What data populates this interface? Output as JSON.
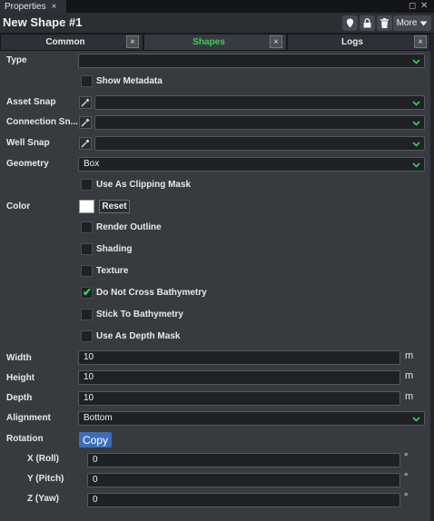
{
  "window": {
    "tab_title": "Properties",
    "tab_close": "×",
    "restore_glyph": "◻",
    "close_glyph": "✕"
  },
  "header": {
    "title": "New Shape #1",
    "icons": [
      "location-pin-icon",
      "lock-icon",
      "trash-icon"
    ],
    "more_label": "More",
    "more_icon": "caret-down-icon"
  },
  "tabs": [
    {
      "label": "Common",
      "active": false,
      "close": "×"
    },
    {
      "label": "Shapes",
      "active": true,
      "close": "×"
    },
    {
      "label": "Logs",
      "active": false,
      "close": "×"
    }
  ],
  "accent_color": "#3ccf55",
  "button_color": "#3b6eb8",
  "form": {
    "type": {
      "label": "Type",
      "value": ""
    },
    "show_metadata": {
      "label": "Show Metadata",
      "checked": false
    },
    "asset_snap": {
      "label": "Asset Snap",
      "value": "",
      "icon": "eyedropper-icon"
    },
    "connection_snap": {
      "label": "Connection Sn...",
      "value": "",
      "icon": "eyedropper-icon"
    },
    "well_snap": {
      "label": "Well Snap",
      "value": "",
      "icon": "eyedropper-icon"
    },
    "geometry": {
      "label": "Geometry",
      "value": "Box"
    },
    "clipping_mask": {
      "label": "Use As Clipping Mask",
      "checked": false
    },
    "color": {
      "label": "Color",
      "swatch": "#ffffff",
      "reset_label": "Reset"
    },
    "render_outline": {
      "label": "Render Outline",
      "checked": false
    },
    "shading": {
      "label": "Shading",
      "checked": false
    },
    "texture": {
      "label": "Texture",
      "checked": false
    },
    "no_cross_bathymetry": {
      "label": "Do Not Cross Bathymetry",
      "checked": true
    },
    "stick_to_bathymetry": {
      "label": "Stick To Bathymetry",
      "checked": false
    },
    "depth_mask": {
      "label": "Use As Depth Mask",
      "checked": false
    },
    "width": {
      "label": "Width",
      "value": "10",
      "unit": "m"
    },
    "height": {
      "label": "Height",
      "value": "10",
      "unit": "m"
    },
    "depth": {
      "label": "Depth",
      "value": "10",
      "unit": "m"
    },
    "alignment": {
      "label": "Alignment",
      "value": "Bottom"
    },
    "rotation": {
      "label": "Rotation",
      "copy_label": "Copy",
      "x": {
        "label": "X (Roll)",
        "value": "0",
        "unit": "°"
      },
      "y": {
        "label": "Y (Pitch)",
        "value": "0",
        "unit": "°"
      },
      "z": {
        "label": "Z (Yaw)",
        "value": "0",
        "unit": "°"
      }
    }
  }
}
